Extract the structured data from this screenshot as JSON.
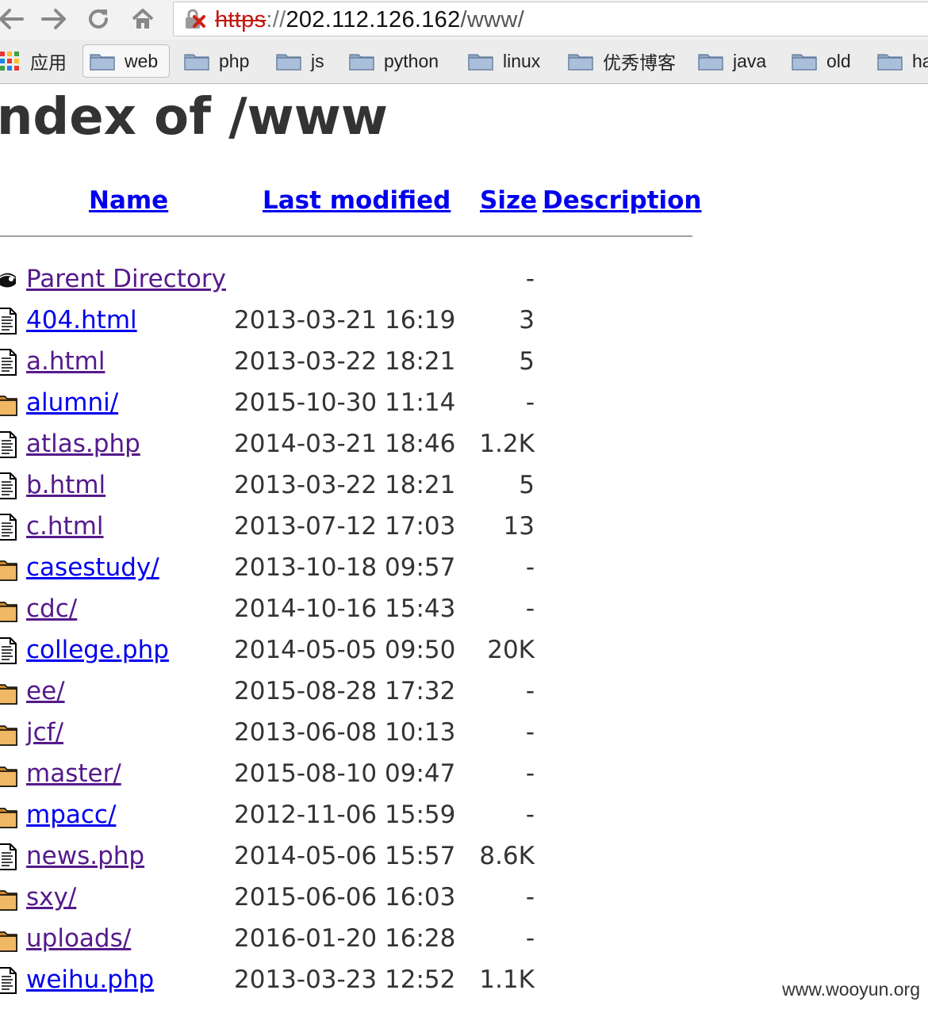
{
  "browser": {
    "url_scheme": "https",
    "url_separator": "://",
    "url_host": "202.112.126.162",
    "url_path": "/www/"
  },
  "bookmarks": {
    "apps_label": "应用",
    "items": [
      {
        "label": "web"
      },
      {
        "label": "php"
      },
      {
        "label": "js"
      },
      {
        "label": "python"
      },
      {
        "label": "linux"
      },
      {
        "label": "优秀博客"
      },
      {
        "label": "java"
      },
      {
        "label": "old"
      },
      {
        "label": "ha"
      }
    ]
  },
  "page": {
    "title": "Index of /www",
    "columns": {
      "name": "Name",
      "last_modified": "Last modified",
      "size": "Size",
      "description": "Description"
    },
    "entries": [
      {
        "name": "Parent Directory",
        "date": "",
        "size": "-",
        "type": "parent",
        "visited": true
      },
      {
        "name": "404.html",
        "date": "2013-03-21 16:19",
        "size": "3",
        "type": "file",
        "visited": false
      },
      {
        "name": "a.html",
        "date": "2013-03-22 18:21",
        "size": "5",
        "type": "file",
        "visited": true
      },
      {
        "name": "alumni/",
        "date": "2015-10-30 11:14",
        "size": "-",
        "type": "folder",
        "visited": false
      },
      {
        "name": "atlas.php",
        "date": "2014-03-21 18:46",
        "size": "1.2K",
        "type": "file",
        "visited": true
      },
      {
        "name": "b.html",
        "date": "2013-03-22 18:21",
        "size": "5",
        "type": "file",
        "visited": true
      },
      {
        "name": "c.html",
        "date": "2013-07-12 17:03",
        "size": "13",
        "type": "file",
        "visited": true
      },
      {
        "name": "casestudy/",
        "date": "2013-10-18 09:57",
        "size": "-",
        "type": "folder",
        "visited": false
      },
      {
        "name": "cdc/",
        "date": "2014-10-16 15:43",
        "size": "-",
        "type": "folder",
        "visited": true
      },
      {
        "name": "college.php",
        "date": "2014-05-05 09:50",
        "size": "20K",
        "type": "file",
        "visited": false
      },
      {
        "name": "ee/",
        "date": "2015-08-28 17:32",
        "size": "-",
        "type": "folder",
        "visited": true
      },
      {
        "name": "jcf/",
        "date": "2013-06-08 10:13",
        "size": "-",
        "type": "folder",
        "visited": true
      },
      {
        "name": "master/",
        "date": "2015-08-10 09:47",
        "size": "-",
        "type": "folder",
        "visited": true
      },
      {
        "name": "mpacc/",
        "date": "2012-11-06 15:59",
        "size": "-",
        "type": "folder",
        "visited": false
      },
      {
        "name": "news.php",
        "date": "2014-05-06 15:57",
        "size": "8.6K",
        "type": "file",
        "visited": true
      },
      {
        "name": "sxy/",
        "date": "2015-06-06 16:03",
        "size": "-",
        "type": "folder",
        "visited": true
      },
      {
        "name": "uploads/",
        "date": "2016-01-20 16:28",
        "size": "-",
        "type": "folder",
        "visited": true
      },
      {
        "name": "weihu.php",
        "date": "2013-03-23 12:52",
        "size": "1.1K",
        "type": "file",
        "visited": false
      }
    ]
  },
  "watermark": "www.wooyun.org",
  "colors": {
    "link": "#0000ee",
    "visited": "#551a8b",
    "insecure": "#c1170f",
    "folder_icon": "#e8a94a"
  }
}
